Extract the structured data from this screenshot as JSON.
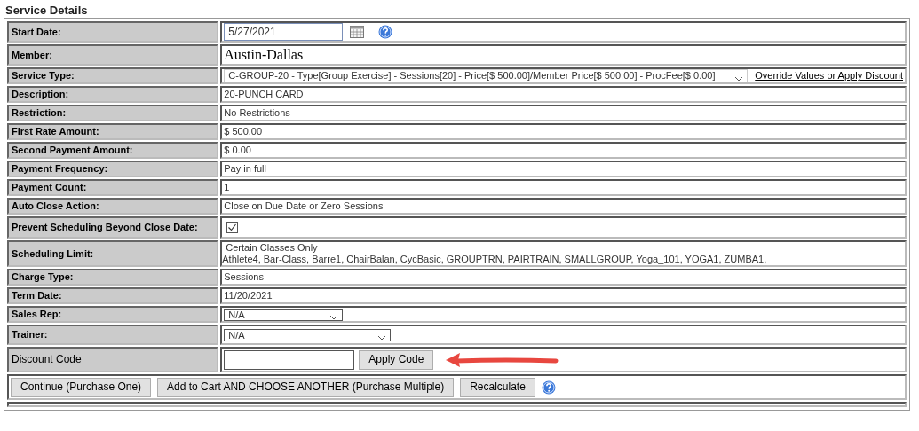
{
  "section_title": "Service Details",
  "rows": [
    {
      "kind": "date",
      "label": "Start Date:",
      "value": "5/27/2021"
    },
    {
      "kind": "member",
      "label": "Member:",
      "value": "Austin-Dallas"
    },
    {
      "kind": "select_link",
      "label": "Service Type:",
      "value": "C-GROUP-20 - Type[Group Exercise] - Sessions[20] - Price[$ 500.00]/Member Price[$ 500.00] - ProcFee[$ 0.00]",
      "link": "Override Values or Apply Discount"
    },
    {
      "kind": "text",
      "label": "Description:",
      "value": "20-PUNCH CARD"
    },
    {
      "kind": "text",
      "label": "Restriction:",
      "value": "No Restrictions"
    },
    {
      "kind": "text",
      "label": "First Rate Amount:",
      "value": "$ 500.00"
    },
    {
      "kind": "text",
      "label": "Second Payment Amount:",
      "value": "$ 0.00"
    },
    {
      "kind": "text",
      "label": "Payment Frequency:",
      "value": "Pay in full"
    },
    {
      "kind": "text",
      "label": "Payment Count:",
      "value": "1"
    },
    {
      "kind": "text",
      "label": "Auto Close Action:",
      "value": "Close on Due Date or Zero Sessions"
    },
    {
      "kind": "checkbox",
      "label": "Prevent Scheduling Beyond Close Date:",
      "checked": true
    },
    {
      "kind": "multiline",
      "label": "Scheduling Limit:",
      "lines": [
        "Certain Classes Only",
        "Athlete4, Bar-Class, Barre1, ChairBalan, CycBasic, GROUPTRN, PAIRTRAIN, SMALLGROUP, Yoga_101, YOGA1, ZUMBA1,"
      ]
    },
    {
      "kind": "text",
      "label": "Charge Type:",
      "value": "Sessions"
    },
    {
      "kind": "text",
      "label": "Term Date:",
      "value": "11/20/2021"
    },
    {
      "kind": "select_short",
      "label": "Sales Rep:",
      "value": "N/A"
    },
    {
      "kind": "select_long",
      "label": "Trainer:",
      "value": "N/A"
    },
    {
      "kind": "discount",
      "label": "Discount Code",
      "button": "Apply Code"
    }
  ],
  "buttons": [
    "Continue (Purchase One)",
    "Add to Cart AND CHOOSE ANOTHER (Purchase Multiple)",
    "Recalculate"
  ]
}
